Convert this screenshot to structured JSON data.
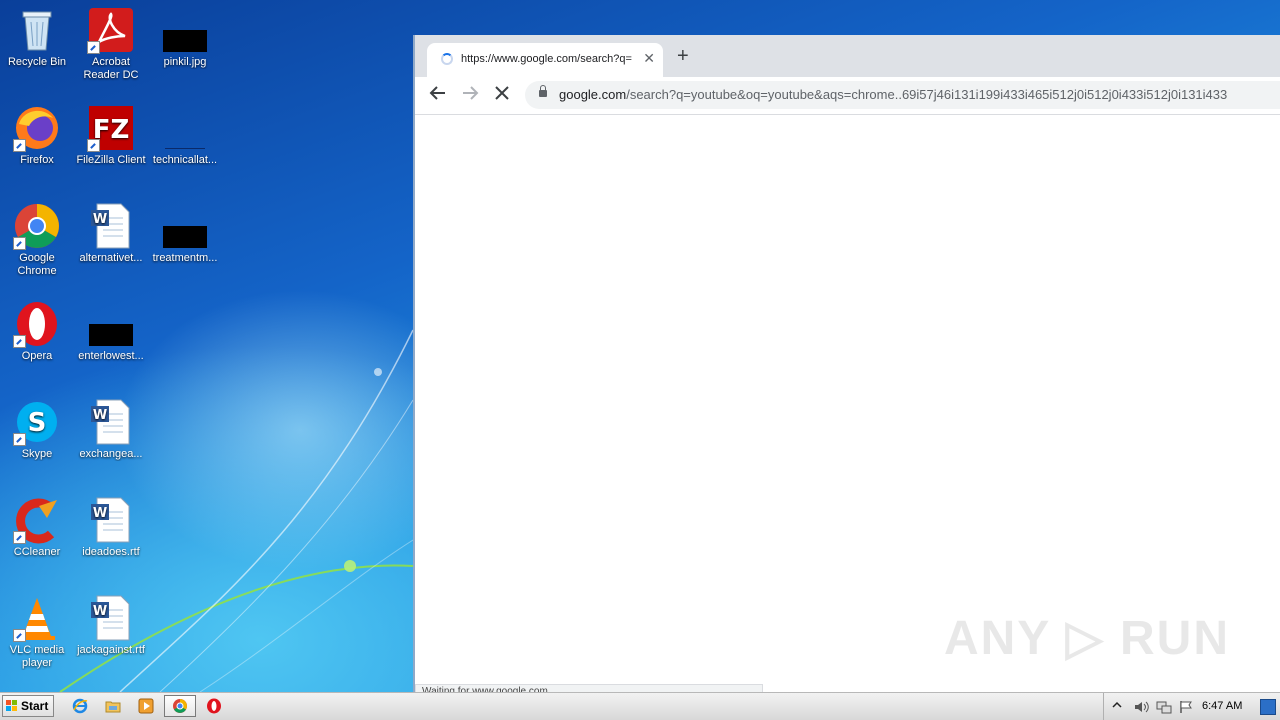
{
  "desktop": {
    "icons": [
      {
        "label": "Recycle Bin"
      },
      {
        "label": "Acrobat Reader DC"
      },
      {
        "label": "pinkil.jpg"
      },
      {
        "label": "Firefox"
      },
      {
        "label": "FileZilla Client"
      },
      {
        "label": "technicallat..."
      },
      {
        "label": "Google Chrome"
      },
      {
        "label": "alternativet..."
      },
      {
        "label": "treatmentm..."
      },
      {
        "label": "Opera"
      },
      {
        "label": "enterlowest..."
      },
      {
        "label": "Skype"
      },
      {
        "label": "exchangea..."
      },
      {
        "label": "CCleaner"
      },
      {
        "label": "ideadoes.rtf"
      },
      {
        "label": "VLC media player"
      },
      {
        "label": "jackagainst.rtf"
      }
    ]
  },
  "browser": {
    "tab_title": "https://www.google.com/search?q=",
    "tab_close": "✕",
    "new_tab": "+",
    "url_host": "google.com",
    "url_path": "/search?q=youtube&oq=youtube&aqs=chrome..69i57j46i131i199i433i465i512j0i512j0i433i512j0i131i433",
    "status_text": "Waiting for www.google.com...",
    "watermark": "ANY ▷ RUN"
  },
  "taskbar": {
    "start_label": "Start",
    "clock": "6:47 AM"
  },
  "colors": {
    "accent": "#1a73e8",
    "desktop_blue": "#1464c8"
  }
}
